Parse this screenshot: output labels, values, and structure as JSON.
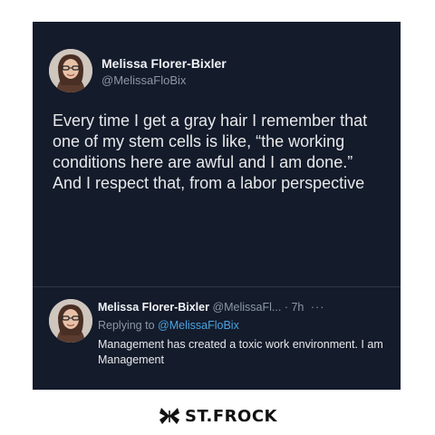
{
  "tweet": {
    "author_name": "Melissa Florer-Bixler",
    "author_handle": "@MelissaFloBix",
    "text": "Every time I get a gray hair I remember that one of my stem cells is like, “the working conditions here are awful and I am done.” And I respect that, from a labor perspective"
  },
  "reply": {
    "author_name": "Melissa Florer-Bixler",
    "author_handle": "@MelissaFl...",
    "time": "· 7h",
    "more": "···",
    "replying_prefix": "Replying to",
    "replying_to": "@MelissaFloBix",
    "text": "Management has created a toxic work environment. I am Management"
  },
  "watermark": {
    "text": "ST.FROCK",
    "icon": "butterfly-icon"
  },
  "colors": {
    "card_bg": "#141b2b",
    "text_primary": "#e7e9ea",
    "text_secondary": "#8b98a5",
    "link": "#4aa3df"
  }
}
